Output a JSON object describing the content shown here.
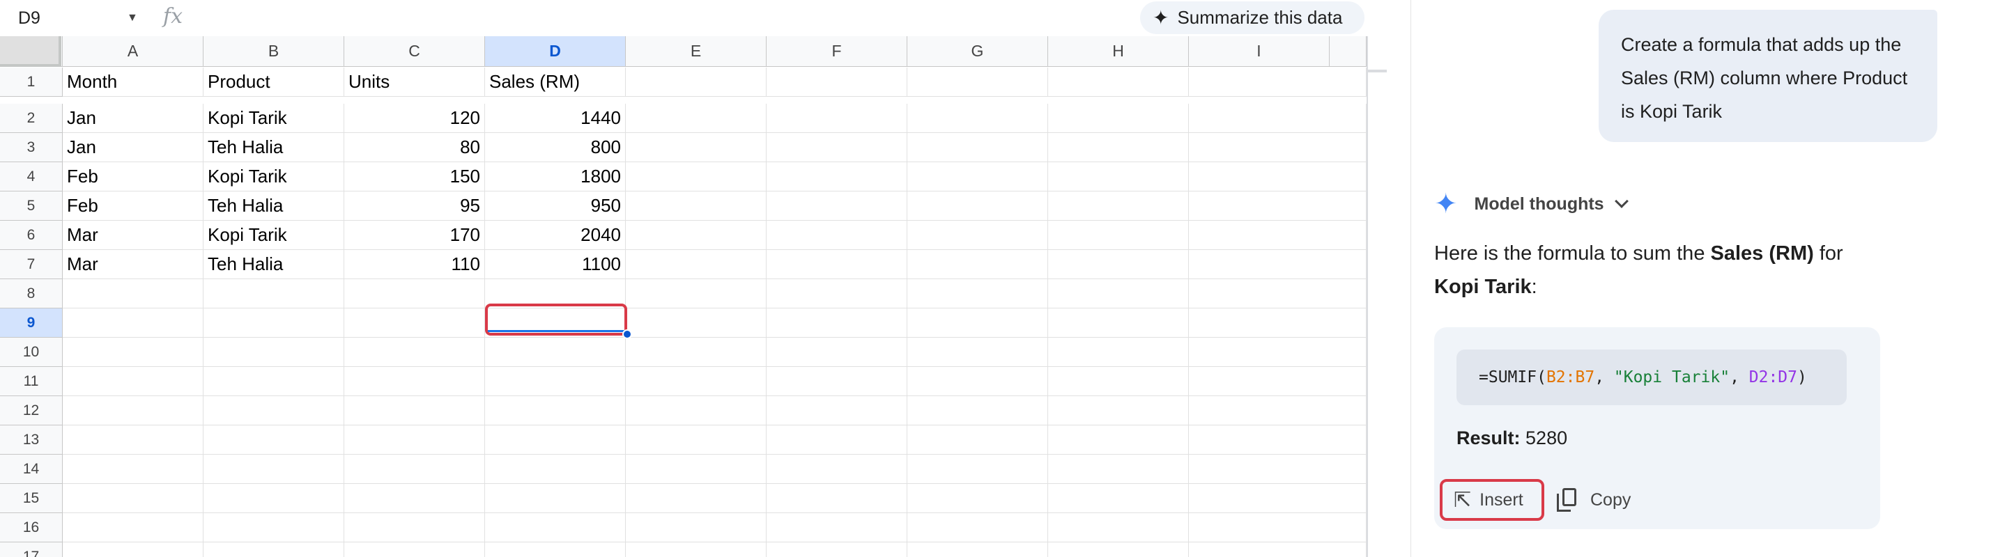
{
  "formula_bar": {
    "name_box": "D9",
    "fx_symbol": "fx",
    "summarize_button": "Summarize this data"
  },
  "sheet": {
    "columns": [
      "A",
      "B",
      "C",
      "D",
      "E",
      "F",
      "G",
      "H",
      "I"
    ],
    "selected_column": "D",
    "rows": [
      "1",
      "2",
      "3",
      "4",
      "5",
      "6",
      "7",
      "8",
      "9",
      "10",
      "11",
      "12",
      "13",
      "14",
      "15",
      "16",
      "17"
    ],
    "selected_row": "9",
    "cells": [
      [
        "Month",
        "Product",
        "Units",
        "Sales (RM)"
      ],
      [
        "Jan",
        "Kopi Tarik",
        "120",
        "1440"
      ],
      [
        "Jan",
        "Teh Halia",
        "80",
        "800"
      ],
      [
        "Feb",
        "Kopi Tarik",
        "150",
        "1800"
      ],
      [
        "Feb",
        "Teh Halia",
        "95",
        "950"
      ],
      [
        "Mar",
        "Kopi Tarik",
        "170",
        "2040"
      ],
      [
        "Mar",
        "Teh Halia",
        "110",
        "1100"
      ]
    ],
    "active_cell": "D9"
  },
  "panel": {
    "user_message": "Create a formula that adds up the Sales (RM) column where Product is Kopi Tarik",
    "thoughts_label": "Model thoughts",
    "answer": {
      "p1": "Here is the formula to sum the ",
      "b1": "Sales (RM)",
      "p2": " for ",
      "b2": "Kopi Tarik",
      "p3": ":"
    },
    "formula": {
      "start": "=SUMIF(",
      "range1": "B2:B7",
      "sep1": ", ",
      "criterion": "\"Kopi Tarik\"",
      "sep2": ", ",
      "range2": "D2:D7",
      "end": ")"
    },
    "result_label": "Result:",
    "result_value": "5280",
    "insert_label": "Insert",
    "copy_label": "Copy"
  },
  "colors": {
    "accent_red_outline": "#d93a48",
    "selection_blue": "#d3e3fd",
    "gemini_blue": "#4285f4"
  },
  "icons": [
    "sparkle-icon",
    "fx-icon",
    "dropdown-caret-icon",
    "gemini-sparkle-icon",
    "chevron-down-icon",
    "insert-arrow-icon",
    "copy-icon"
  ]
}
